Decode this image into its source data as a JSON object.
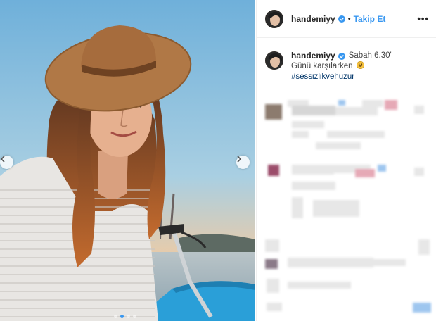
{
  "post": {
    "username": "handemiyy",
    "follow_label": "Takip Et",
    "separator": "•",
    "more_label": "•••",
    "caption": {
      "line1": "Sabah 6.30'",
      "line2": "Günü karşılarken",
      "hashtag": "#sessizlikvehuzur"
    },
    "carousel": {
      "total": 4,
      "active": 1
    }
  },
  "colors": {
    "accent": "#3897f0",
    "hashtag": "#003569",
    "verified": "#3897f0",
    "emoji": "#f5c23e"
  },
  "icons": {
    "verified": "verified-badge-icon",
    "prev": "chevron-left-icon",
    "next": "chevron-right-icon",
    "more": "more-options-icon",
    "emoji": "grinning-face-emoji"
  }
}
